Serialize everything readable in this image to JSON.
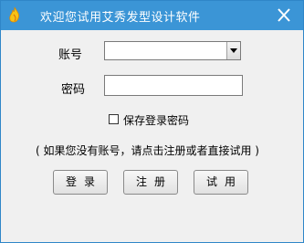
{
  "window": {
    "title": "欢迎您试用艾秀发型设计软件",
    "close_symbol": "✕",
    "icon": "flame-app-icon"
  },
  "form": {
    "account_label": "账号",
    "account_value": "",
    "password_label": "密码",
    "password_value": "",
    "remember_label": "保存登录密码",
    "remember_checked": false,
    "hint": "( 如果您没有账号，请点击注册或者直接试用 )"
  },
  "buttons": {
    "login": "登录",
    "register": "注册",
    "trial": "试用"
  },
  "colors": {
    "titlebar": "#3b95d6",
    "window_bg": "#f0f0f0"
  }
}
